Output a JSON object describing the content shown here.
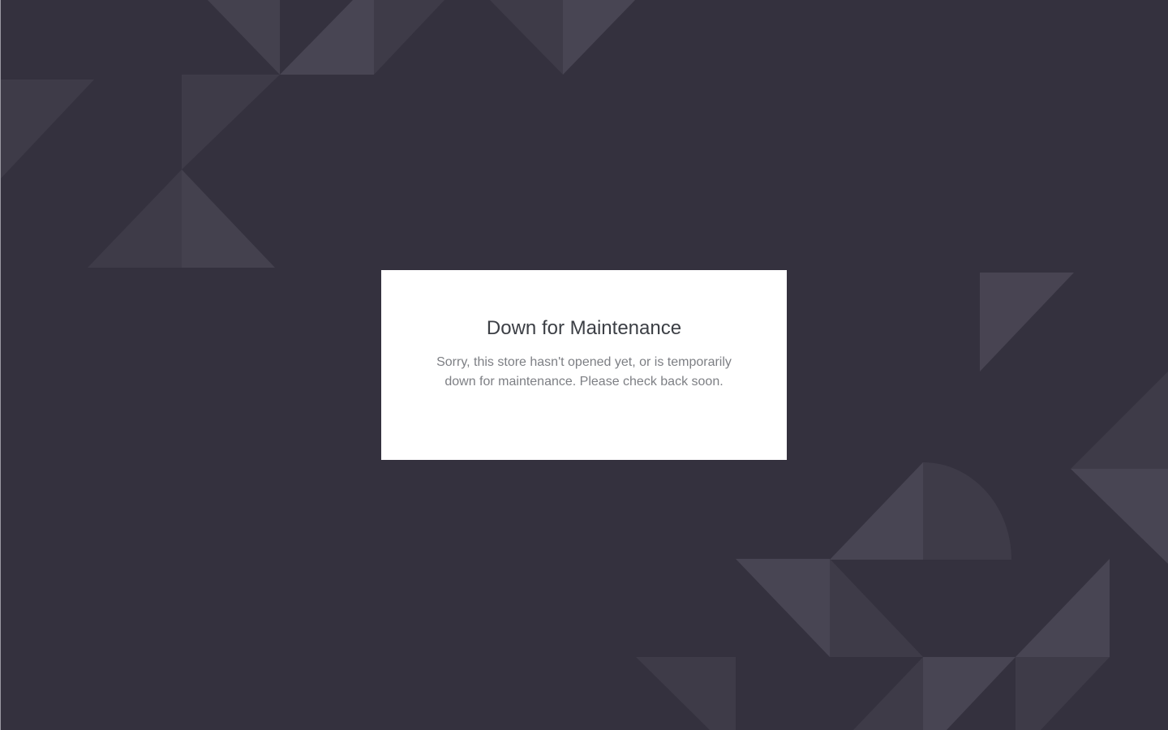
{
  "maintenance": {
    "title": "Down for Maintenance",
    "message": "Sorry, this store hasn't opened yet, or is temporarily down for maintenance. Please check back soon."
  },
  "colors": {
    "background": "#34313e",
    "card": "#ffffff",
    "title": "#3c3f45",
    "message": "#7d7f84"
  }
}
